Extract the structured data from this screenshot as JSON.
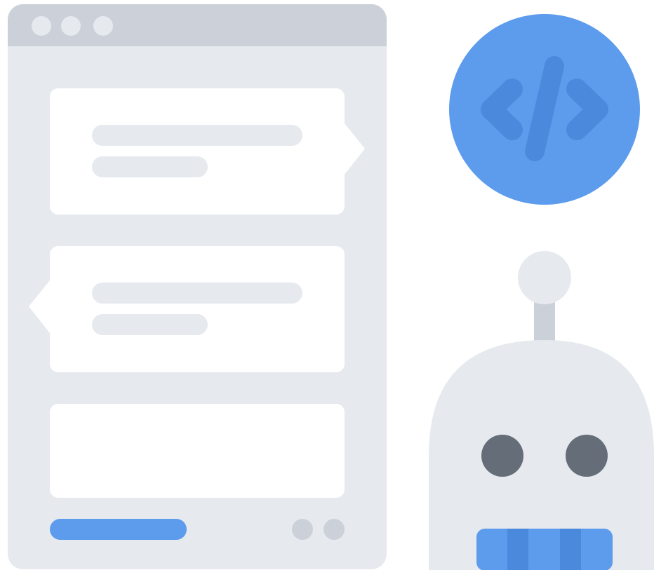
{
  "illustration": {
    "window": {
      "titlebar_dots": 3,
      "message_cards": 2,
      "input_card": 1,
      "page_dots": 2
    },
    "code_badge": {
      "icon": "code-icon"
    },
    "robot": {
      "icon": "robot-icon"
    }
  },
  "colors": {
    "window_body": "#e6e9ee",
    "titlebar": "#ccd1d9",
    "card": "#ffffff",
    "accent_blue": "#5d9cec",
    "accent_blue_dark": "#4a89dc",
    "robot_eye": "#656d78"
  }
}
